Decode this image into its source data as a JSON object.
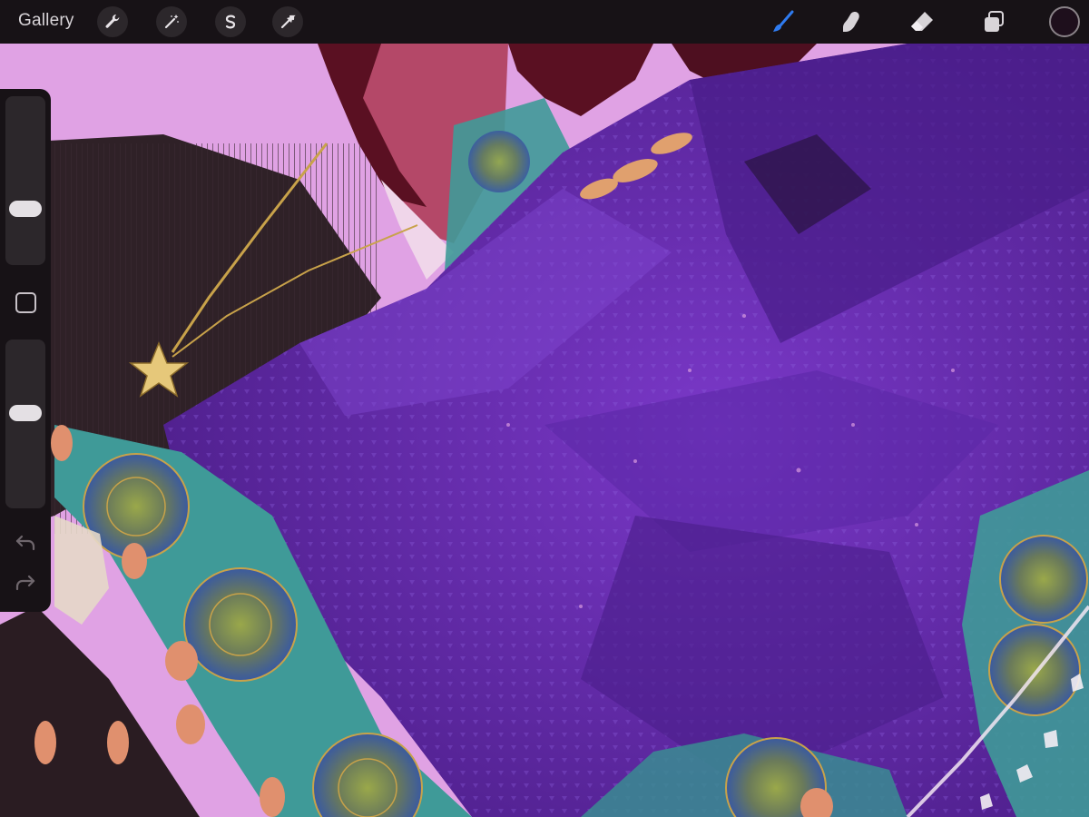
{
  "toolbar": {
    "gallery_label": "Gallery",
    "left_tools": [
      {
        "name": "actions",
        "icon": "wrench-icon"
      },
      {
        "name": "adjustments",
        "icon": "magic-wand-icon"
      },
      {
        "name": "selection",
        "icon": "selection-s-icon"
      },
      {
        "name": "transform",
        "icon": "arrow-cursor-icon"
      }
    ],
    "right_tools": [
      {
        "name": "brush",
        "icon": "brush-icon",
        "active": true
      },
      {
        "name": "smudge",
        "icon": "smudge-finger-icon",
        "active": false
      },
      {
        "name": "eraser",
        "icon": "eraser-icon",
        "active": false
      },
      {
        "name": "layers",
        "icon": "layers-icon",
        "active": false
      }
    ],
    "current_color": "#1e0f1c",
    "active_tool_color": "#2f7bf0"
  },
  "sidebar": {
    "brush_size_level": 0.3,
    "opacity_level": 0.58,
    "modifier_icon": "square-modifier-icon",
    "undo_icon": "undo-arrow-icon",
    "redo_icon": "redo-arrow-icon"
  },
  "canvas": {
    "description_colors": {
      "background_pink": "#e2a6e6",
      "dark_cloth": "#2e2026",
      "purple_cape": "#6a2cb4",
      "deep_purple": "#4a1d80",
      "teal_trim": "#4aa6a0",
      "gold_accent": "#c8a24a",
      "skin": "#b64a6a",
      "hair": "#5a1020",
      "tassel": "#e09074"
    }
  }
}
